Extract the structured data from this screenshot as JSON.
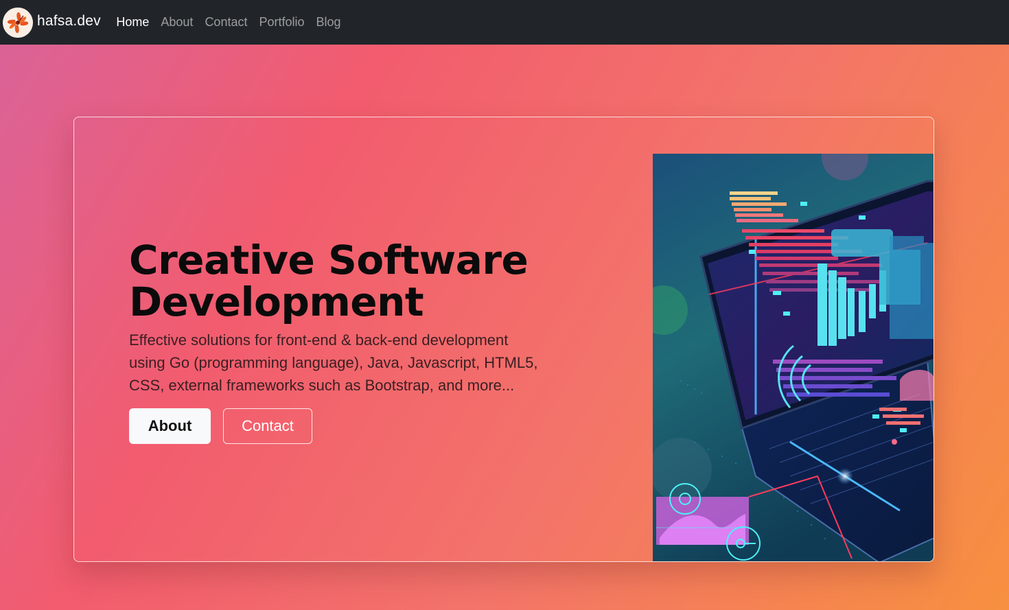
{
  "navbar": {
    "brand": "hafsa.dev",
    "brand_logo_icon": "hibiscus-flower-icon",
    "links": [
      {
        "label": "Home",
        "active": true
      },
      {
        "label": "About",
        "active": false
      },
      {
        "label": "Contact",
        "active": false
      },
      {
        "label": "Portfolio",
        "active": false
      },
      {
        "label": "Blog",
        "active": false
      }
    ]
  },
  "hero": {
    "title": "Creative Software Development",
    "description": "Effective solutions for front-end & back-end development using Go (programming language), Java, Javascript, HTML5, CSS, external frameworks such as Bootstrap, and more...",
    "buttons": {
      "about": "About",
      "contact": "Contact"
    },
    "image_icon": "isometric-laptop-code-illustration"
  },
  "colors": {
    "navbar_bg": "#212529",
    "gradient_start": "#d9639a",
    "gradient_end": "#f7903f"
  }
}
